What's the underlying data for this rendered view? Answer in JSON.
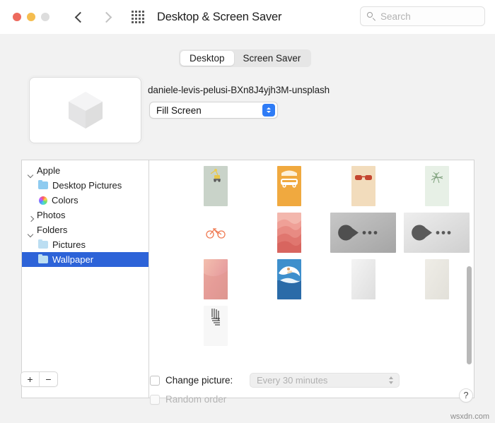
{
  "window": {
    "title": "Desktop & Screen Saver",
    "traffic_lights": [
      "close",
      "minimize",
      "zoom"
    ],
    "nav": {
      "back": "back-chevron",
      "forward": "forward-chevron"
    },
    "grid_button": "show-all-icon"
  },
  "search": {
    "placeholder": "Search",
    "value": "",
    "icon": "search-icon"
  },
  "tabs": [
    {
      "label": "Desktop",
      "active": true
    },
    {
      "label": "Screen Saver",
      "active": false
    }
  ],
  "preview": {
    "picture_name": "daniele-levis-pelusi-BXn8J4yjh3M-unsplash",
    "fit_mode": "Fill Screen",
    "thumbnail": "grey-cube-wallpaper"
  },
  "sidebar": {
    "items": [
      {
        "label": "Apple",
        "level": 0,
        "twisty": "open",
        "icon": null,
        "selected": false
      },
      {
        "label": "Desktop Pictures",
        "level": 1,
        "twisty": null,
        "icon": "folder-icon",
        "selected": false
      },
      {
        "label": "Colors",
        "level": 1,
        "twisty": null,
        "icon": "color-wheel-icon",
        "selected": false
      },
      {
        "label": "Photos",
        "level": 0,
        "twisty": "closed",
        "icon": null,
        "selected": false
      },
      {
        "label": "Folders",
        "level": 0,
        "twisty": "open",
        "icon": null,
        "selected": false
      },
      {
        "label": "Pictures",
        "level": 1,
        "twisty": null,
        "icon": "folder-icon-pale",
        "selected": false
      },
      {
        "label": "Wallpaper",
        "level": 1,
        "twisty": null,
        "icon": "folder-icon",
        "selected": true
      }
    ]
  },
  "thumbnails": {
    "rows": [
      [
        {
          "name": "crane-sage",
          "orientation": "portrait",
          "bg": "#c9d3c9"
        },
        {
          "name": "van-orange",
          "orientation": "portrait",
          "bg": "#f0a93f"
        },
        {
          "name": "sunglasses-tan",
          "orientation": "portrait",
          "bg": "#f2dcbc"
        },
        {
          "name": "leaves-pale-green",
          "orientation": "portrait",
          "bg": "#e7f0e6"
        }
      ],
      [
        {
          "name": "bicycle-white",
          "orientation": "portrait",
          "bg": "#ffffff"
        },
        {
          "name": "waves-pink",
          "orientation": "portrait",
          "bg": "#e9847e"
        },
        {
          "name": "pacman-grey-dark",
          "orientation": "landscape",
          "bg": "#b4b4b4"
        },
        {
          "name": "pacman-grey-light",
          "orientation": "landscape",
          "bg": "#dcdcdc"
        }
      ],
      [
        {
          "name": "gradient-pink",
          "orientation": "portrait",
          "bg": "#e8a79a"
        },
        {
          "name": "surfer-wave-blue",
          "orientation": "portrait",
          "bg": "#2f7bbf"
        },
        {
          "name": "light-grey-plain",
          "orientation": "portrait",
          "bg": "#ededed"
        },
        {
          "name": "beige-plain",
          "orientation": "portrait",
          "bg": "#e8e6e0"
        }
      ],
      [
        {
          "name": "stripes-white",
          "orientation": "portrait",
          "bg": "#f6f6f6"
        }
      ]
    ]
  },
  "bottom": {
    "add_label": "+",
    "remove_label": "−",
    "change_picture_label": "Change picture:",
    "change_picture_checked": false,
    "interval_value": "Every 30 minutes",
    "interval_enabled": false,
    "random_order_label": "Random order",
    "random_order_enabled": false,
    "help_label": "?"
  },
  "watermark": "wsxdn.com",
  "colors": {
    "accent_blue": "#2f7cf6",
    "selection_blue": "#2d63d8",
    "traffic_red": "#ed6a5e",
    "traffic_yellow": "#f5bd4f",
    "traffic_grey": "#dddddd"
  }
}
